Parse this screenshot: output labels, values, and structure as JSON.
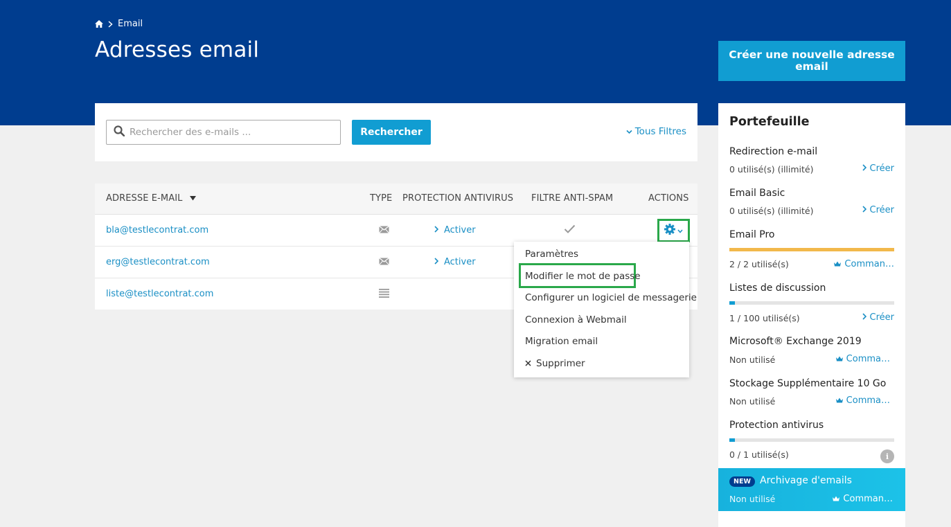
{
  "breadcrumb": {
    "current": "Email"
  },
  "header": {
    "title": "Adresses email",
    "create_button": "Créer une nouvelle adresse email"
  },
  "search": {
    "placeholder": "Rechercher des e-mails ...",
    "button": "Rechercher",
    "filters": "Tous Filtres"
  },
  "table": {
    "columns": [
      "ADRESSE E-MAIL",
      "TYPE",
      "PROTECTION ANTIVIRUS",
      "FILTRE ANTI-SPAM",
      "ACTIONS"
    ],
    "sort_column": "ADRESSE E-MAIL",
    "rows": [
      {
        "email": "bla@testlecontrat.com",
        "type_icon": "envelope-icon",
        "antivirus": "Activer",
        "antispam": "check-icon"
      },
      {
        "email": "erg@testlecontrat.com",
        "type_icon": "envelope-icon",
        "antivirus": "Activer",
        "antispam": ""
      },
      {
        "email": "liste@testlecontrat.com",
        "type_icon": "list-icon",
        "antivirus": "",
        "antispam": ""
      }
    ]
  },
  "actions_menu": {
    "items": [
      "Paramètres",
      "Modifier le mot de passe",
      "Configurer un logiciel de messagerie",
      "Connexion à Webmail",
      "Migration email",
      "Supprimer"
    ],
    "highlighted": "Modifier le mot de passe"
  },
  "portfolio": {
    "title": "Portefeuille",
    "items": [
      {
        "name": "Redirection e-mail",
        "usage": "0 utilisé(s) (illimité)",
        "action": "Créer",
        "action_icon": "chevron-right-icon"
      },
      {
        "name": "Email Basic",
        "usage": "0 utilisé(s) (illimité)",
        "action": "Créer",
        "action_icon": "chevron-right-icon"
      },
      {
        "name": "Email Pro",
        "usage": "2 / 2 utilisé(s)",
        "action": "Comman…",
        "action_icon": "crown-icon",
        "fill": 1.0,
        "bar_color": "#f2b84b"
      },
      {
        "name": "Listes de discussion",
        "usage": "1 / 100 utilisé(s)",
        "action": "Créer",
        "action_icon": "chevron-right-icon",
        "fill": 0.01,
        "bar_color": "#119dd2"
      },
      {
        "name": "Microsoft® Exchange 2019",
        "usage": "Non utilisé",
        "action": "Comma…",
        "action_icon": "crown-icon"
      },
      {
        "name": "Stockage Supplémentaire 10 Go",
        "usage": "Non utilisé",
        "action": "Comma…",
        "action_icon": "crown-icon"
      },
      {
        "name": "Protection antivirus",
        "usage": "0 / 1 utilisé(s)",
        "action_icon": "info-icon",
        "fill": 0.0,
        "bar_color": "#119dd2"
      }
    ],
    "archive": {
      "badge": "NEW",
      "name": "Archivage d'emails",
      "usage": "Non utilisé",
      "action": "Comman…"
    }
  },
  "colors": {
    "header_bg": "#003d8f",
    "primary": "#119dd2",
    "link": "#1a8fc5",
    "highlight": "#2aa84a",
    "page_bg": "#f0f0f0"
  }
}
